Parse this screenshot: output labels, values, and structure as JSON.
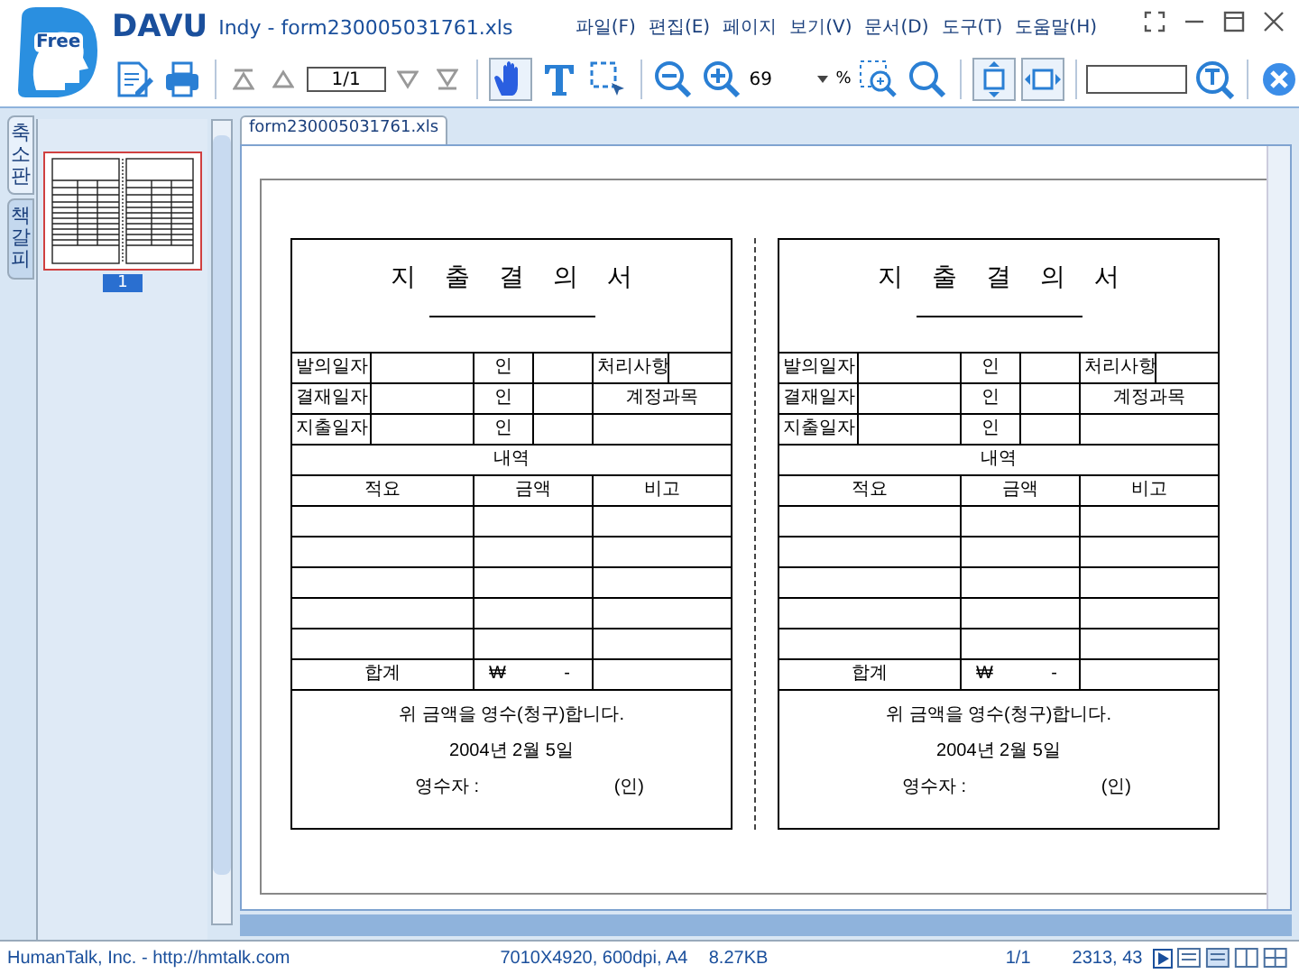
{
  "app": {
    "logo": "Free",
    "name": "DAVU",
    "title": "Indy - form230005031761.xls"
  },
  "menu": [
    "파일(F)",
    "편집(E)",
    "페이지",
    "보기(V)",
    "문서(D)",
    "도구(T)",
    "도움말(H)"
  ],
  "toolbar": [
    {
      "kind": "edit"
    },
    {
      "kind": "print"
    },
    {
      "kind": "separator"
    },
    {
      "kind": "first"
    },
    {
      "kind": "prev"
    },
    {
      "kind": "page-field",
      "value": "1/1"
    },
    {
      "kind": "next"
    },
    {
      "kind": "last"
    },
    {
      "kind": "separator"
    },
    {
      "kind": "hand",
      "selected": true
    },
    {
      "kind": "text",
      "selected": false
    },
    {
      "kind": "select",
      "selected": false
    },
    {
      "kind": "separator"
    },
    {
      "kind": "zoom-out"
    },
    {
      "kind": "zoom-in"
    },
    {
      "kind": "zoom-field",
      "value": "69",
      "unit": "%"
    },
    {
      "kind": "zoom-area"
    },
    {
      "kind": "magnifier"
    },
    {
      "kind": "separator"
    },
    {
      "kind": "fit-height",
      "selected": true
    },
    {
      "kind": "fit-width",
      "selected": true
    },
    {
      "kind": "separator"
    },
    {
      "kind": "search-field"
    },
    {
      "kind": "search"
    },
    {
      "kind": "separator"
    },
    {
      "kind": "close"
    }
  ],
  "side_tabs": [
    {
      "label": "축소판",
      "selected": true
    },
    {
      "label": "책갈피",
      "selected": false
    }
  ],
  "thumbnails": [
    {
      "label": "1",
      "selected": true
    }
  ],
  "document": {
    "tab": "form230005031761.xls",
    "forms": [
      {
        "title": "지 출 결 의 서",
        "rows": [
          {
            "label": "발의일자",
            "seal": "인",
            "side": {
              "kind": "pair",
              "text": "처리사항"
            }
          },
          {
            "label": "결재일자",
            "seal": "인",
            "side": {
              "kind": "span",
              "text": "계정과목"
            }
          },
          {
            "label": "지출일자",
            "seal": "인"
          }
        ],
        "detail": "내역",
        "columns": [
          "적요",
          "금액",
          "비고"
        ],
        "total": {
          "label": "합계",
          "currency": "₩",
          "amount": "-"
        },
        "statement": "위 금액을 영수(청구)합니다.",
        "date": "2004년 2월 5일",
        "receiver": "영수자 :",
        "seal": "(인)"
      },
      {
        "title": "지 출 결 의 서",
        "rows": [
          {
            "label": "발의일자",
            "seal": "인",
            "side": {
              "kind": "pair",
              "text": "처리사항"
            }
          },
          {
            "label": "결재일자",
            "seal": "인",
            "side": {
              "kind": "span",
              "text": "계정과목"
            }
          },
          {
            "label": "지출일자",
            "seal": "인"
          }
        ],
        "detail": "내역",
        "columns": [
          "적요",
          "금액",
          "비고"
        ],
        "total": {
          "label": "합계",
          "currency": "₩",
          "amount": "-"
        },
        "statement": "위 금액을 영수(청구)합니다.",
        "date": "2004년 2월 5일",
        "receiver": "영수자 :",
        "seal": "(인)"
      }
    ]
  },
  "status_bar": {
    "company": "HumanTalk, Inc. - http://hmtalk.com",
    "image_info": "7010X4920, 600dpi, A4",
    "size": "8.27KB",
    "page": "1/1",
    "position": "2313, 43"
  }
}
